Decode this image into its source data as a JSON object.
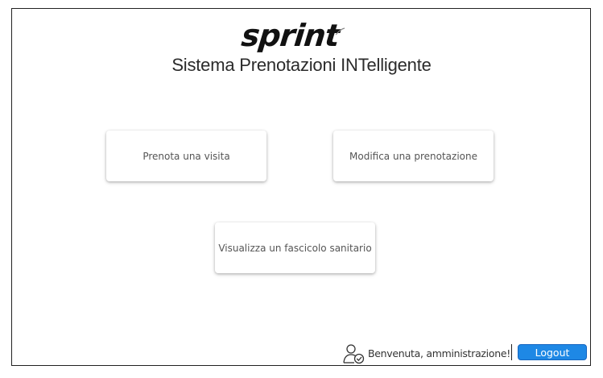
{
  "brand": {
    "logo_text": "sprint"
  },
  "header": {
    "title": "Sistema Prenotazioni INTelligente"
  },
  "actions": [
    {
      "label": "Prenota una visita"
    },
    {
      "label": "Modifica una prenotazione"
    },
    {
      "label": "Visualizza un fascicolo sanitario"
    }
  ],
  "footer": {
    "user_icon": "user-check-icon",
    "welcome_text": "Benvenuta, amministrazione!",
    "logout_label": "Logout"
  },
  "colors": {
    "logout_button": "#1e88e5"
  }
}
